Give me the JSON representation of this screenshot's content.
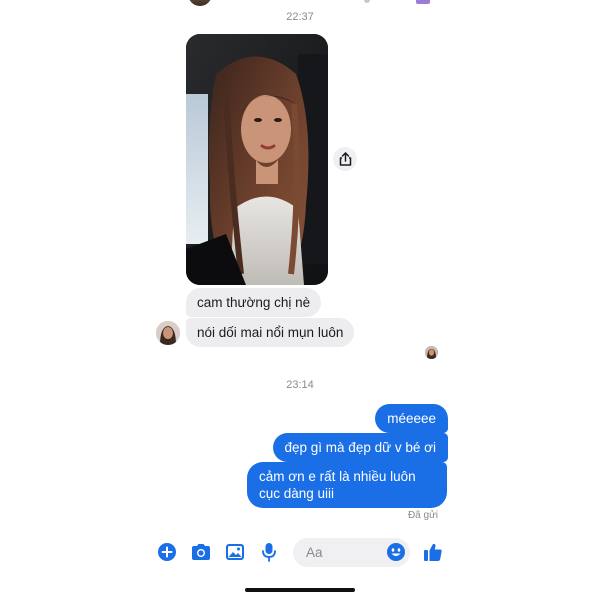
{
  "conversation": {
    "timestamp_1": "22:37",
    "timestamp_2": "23:14",
    "incoming_messages": [
      {
        "text": "cam thường chị nè"
      },
      {
        "text": "nói dối mai nổi mụn luôn"
      }
    ],
    "outgoing_messages": [
      {
        "text": "méeeee"
      },
      {
        "text": "đẹp gì mà đẹp dữ v bé ơi"
      },
      {
        "text": "cảm ơn e rất là nhiều luôn cục dàng uiii"
      }
    ],
    "delivery_status": "Đã gửi"
  },
  "composer": {
    "placeholder": "Aa"
  },
  "colors": {
    "outgoing_bubble": "#1a6fe6",
    "incoming_bubble": "#ededef",
    "accent_icon": "#1a6fe6"
  },
  "icons": {
    "share": "share-icon",
    "plus": "plus-circle-icon",
    "camera": "camera-icon",
    "image": "image-icon",
    "mic": "microphone-icon",
    "emoji": "emoji-icon",
    "like": "thumbs-up-icon"
  }
}
